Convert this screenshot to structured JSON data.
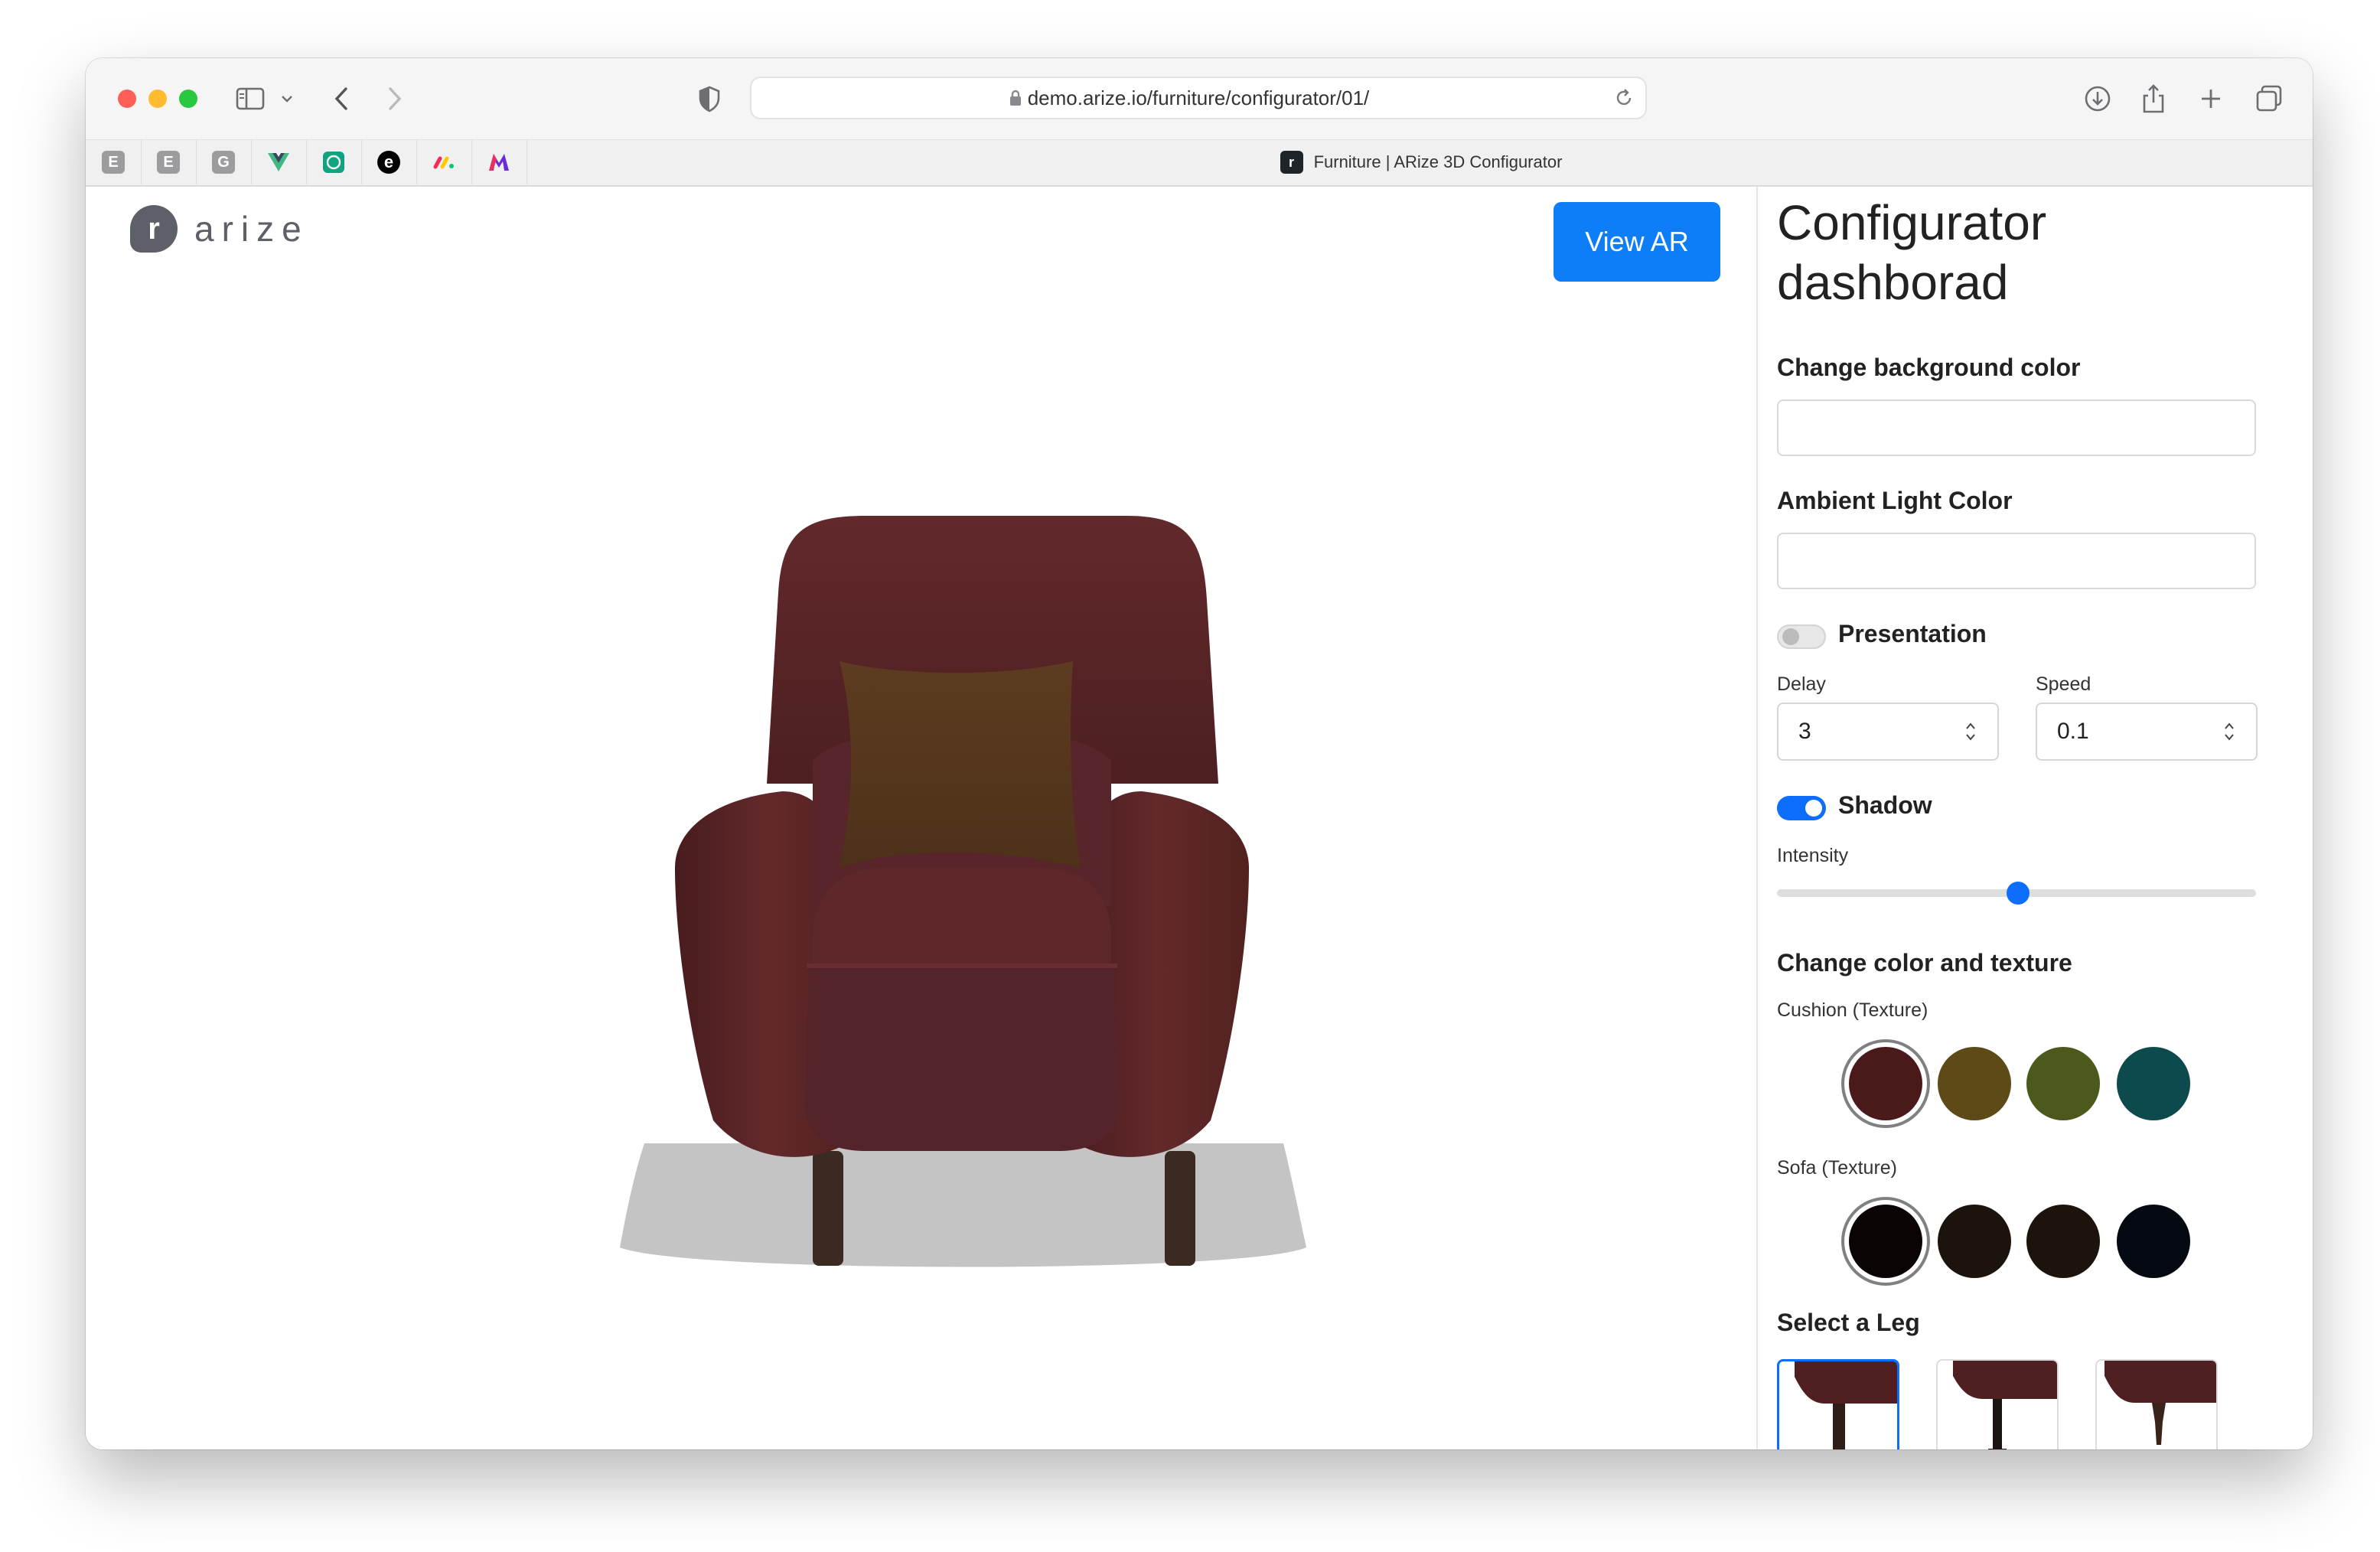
{
  "browser": {
    "url": "demo.arize.io/furniture/configurator/01/",
    "tab_title": "Furniture | ARize 3D Configurator",
    "pinned_tabs": [
      "E",
      "E",
      "G",
      "",
      "",
      "e",
      "",
      ""
    ]
  },
  "header": {
    "logo_text": "arize",
    "logo_mark": "r",
    "view_ar_label": "View AR"
  },
  "panel": {
    "title_line1": "Configurator",
    "title_line2": "dashborad",
    "background_color_label": "Change background color",
    "ambient_light_label": "Ambient Light Color",
    "presentation_label": "Presentation",
    "presentation_on": false,
    "delay_label": "Delay",
    "delay_value": "3",
    "speed_label": "Speed",
    "speed_value": "0.1",
    "shadow_label": "Shadow",
    "shadow_on": true,
    "intensity_label": "Intensity",
    "intensity_fraction": 0.5,
    "color_texture_label": "Change color and texture",
    "cushion_label": "Cushion (Texture)",
    "cushion_swatches": [
      "#4a1a1a",
      "#5e4a16",
      "#4b5a1c",
      "#0c4a4e"
    ],
    "sofa_label": "Sofa (Texture)",
    "sofa_swatches": [
      "#0a0404",
      "#1c140c",
      "#1c140c",
      "#050a12"
    ],
    "select_leg_label": "Select a Leg"
  },
  "colors": {
    "accent": "#0d7ef7",
    "sofa_leather": "#5b2627",
    "cushion": "#5a3a1e"
  }
}
